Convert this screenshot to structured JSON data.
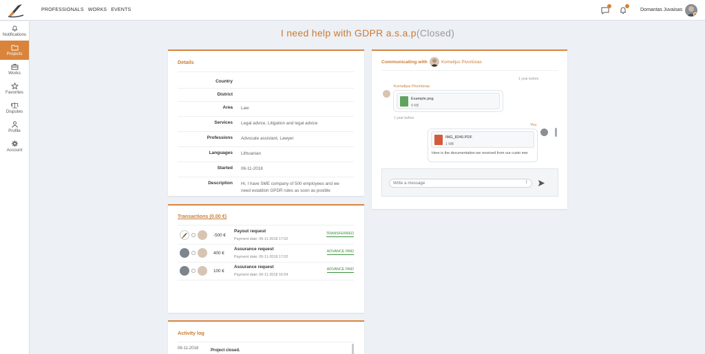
{
  "header": {
    "nav": [
      "PROFESSIONALS",
      "WORKS",
      "EVENTS"
    ],
    "user_name": "Domantas Juvaisas",
    "accent": "#d8843b"
  },
  "sidebar": {
    "items": [
      {
        "label": "Notifications",
        "icon": "bell-icon"
      },
      {
        "label": "Projects",
        "icon": "folder-icon",
        "active": true
      },
      {
        "label": "Works",
        "icon": "briefcase-icon"
      },
      {
        "label": "Favorites",
        "icon": "star-icon"
      },
      {
        "label": "Disputes",
        "icon": "scales-icon"
      },
      {
        "label": "Profile",
        "icon": "user-icon"
      },
      {
        "label": "Account",
        "icon": "gear-icon"
      }
    ]
  },
  "page": {
    "title": "I need help with GDPR a.s.a.p",
    "status": "(Closed)"
  },
  "details": {
    "title": "Details",
    "rows": [
      {
        "label": "Country",
        "value": ""
      },
      {
        "label": "District",
        "value": ""
      },
      {
        "label": "Area",
        "value": "Law"
      },
      {
        "label": "Services",
        "value": "Legal advice, Litigation and legal advice"
      },
      {
        "label": "Professions",
        "value": "Advocate assistant, Lawyer"
      },
      {
        "label": "Languages",
        "value": "Lithuanian"
      },
      {
        "label": "Started",
        "value": "06-11-2018"
      },
      {
        "label": "Description",
        "value": "Hi, I have SME company of 500 employees and we need establish GPDR rules as soon as posible"
      }
    ]
  },
  "transactions": {
    "title": "Transactions (0.00 €)",
    "rows": [
      {
        "amount": "-500 €",
        "type": "Payout request",
        "date": "Payment date: 06-11-2018 17:02",
        "status": "TRANSFERRED"
      },
      {
        "amount": "400 €",
        "type": "Assurance request",
        "date": "Payment date: 06-11-2018 17:02",
        "status": "ADVANCE PAID"
      },
      {
        "amount": "100 €",
        "type": "Assurance request",
        "date": "Payment date: 06-11-2018 16:54",
        "status": "ADVANCE PAID"
      }
    ]
  },
  "chat": {
    "title": "Communicating with",
    "partner": "Kornelijus Pivoriūnas",
    "messages": [
      {
        "time": "1 year before",
        "sender": "Kornelijus Pivoriūnas",
        "file_name": "Example.png",
        "file_size": "9 KB",
        "text": ""
      },
      {
        "time": "1 year before",
        "sender": "You",
        "file_name": "IMG_8240.PDF",
        "file_size": "1 MB",
        "text": "Here is the documentation we received from our custo mer"
      }
    ],
    "input_placeholder": "Write a message"
  },
  "activity": {
    "title": "Activity log",
    "rows": [
      {
        "date": "06-11-2018",
        "text": "Project closed."
      }
    ]
  }
}
